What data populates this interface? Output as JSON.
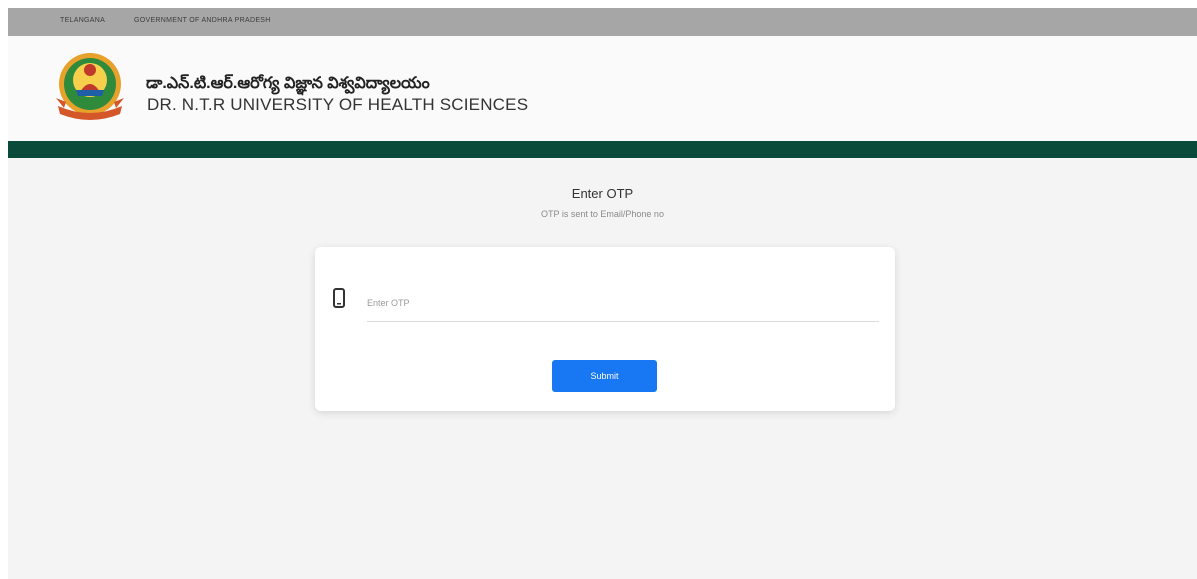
{
  "topbar": {
    "link1": "TELANGANA",
    "link2": "GOVERNMENT OF ANDHRA PRADESH"
  },
  "header": {
    "title_telugu": "డా.ఎన్.టి.ఆర్.ఆరోగ్య విజ్ఞాన విశ్వవిద్యాలయం",
    "title_english": "DR. N.T.R UNIVERSITY OF HEALTH SCIENCES",
    "logo_icon": "university-emblem"
  },
  "otp": {
    "title": "Enter OTP",
    "subtitle": "OTP is sent to Email/Phone no",
    "input_placeholder": "Enter OTP",
    "input_value": "",
    "input_icon": "mobile-phone-icon",
    "submit_label": "Submit"
  },
  "colors": {
    "topbar": "#a6a6a6",
    "header_band": "#0a4a3a",
    "page_background": "#f4f4f4",
    "submit_button": "#1877f2"
  }
}
